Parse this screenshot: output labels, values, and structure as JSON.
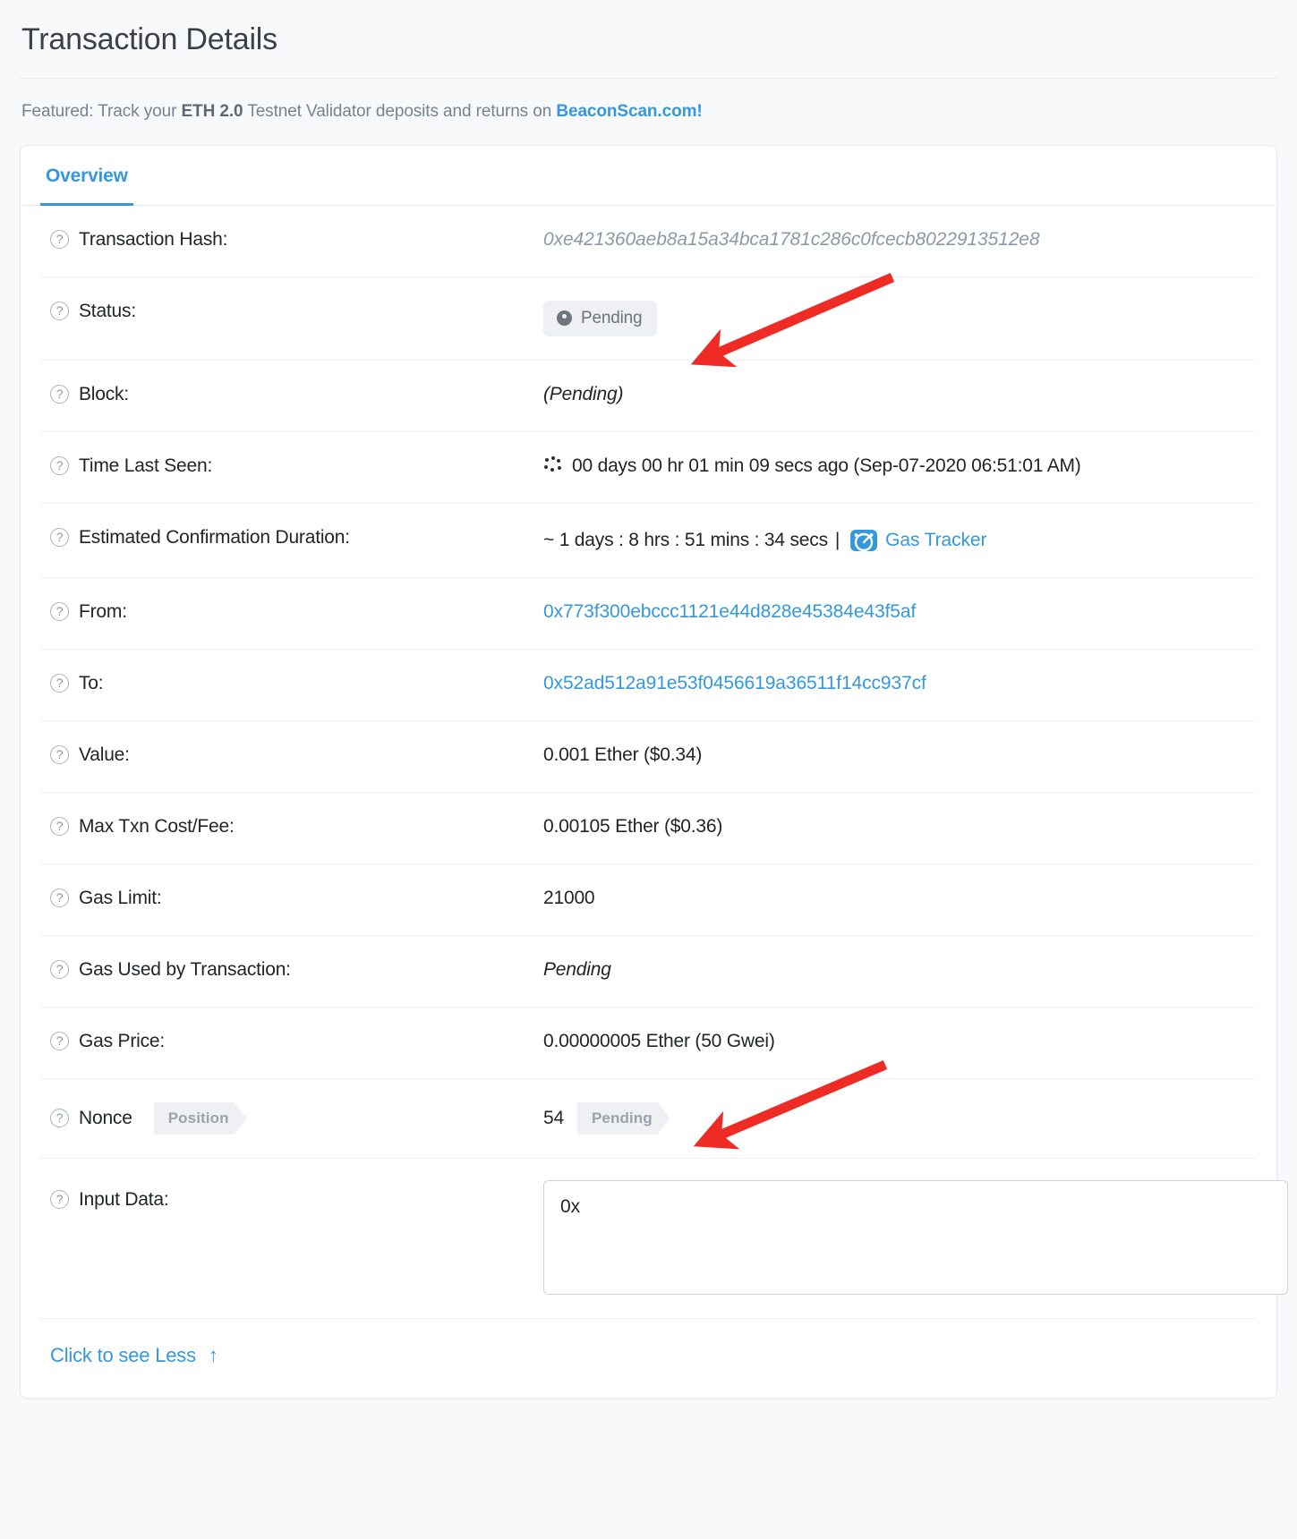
{
  "header": {
    "title": "Transaction Details"
  },
  "featured": {
    "prefix": "Featured: Track your ",
    "bold": "ETH 2.0",
    "middle": " Testnet Validator deposits and returns on ",
    "link": "BeaconScan.com!"
  },
  "tabs": [
    {
      "label": "Overview",
      "active": true
    }
  ],
  "rows": {
    "transaction_hash": {
      "label": "Transaction Hash:",
      "value": "0xe421360aeb8a15a34bca1781c286c0fcecb8022913512e8"
    },
    "status": {
      "label": "Status:",
      "badge": "Pending"
    },
    "block": {
      "label": "Block:",
      "value": "(Pending)"
    },
    "time_last_seen": {
      "label": "Time Last Seen:",
      "value": "00 days 00 hr 01 min 09 secs ago (Sep-07-2020 06:51:01 AM)"
    },
    "estimated_confirmation": {
      "label": "Estimated Confirmation Duration:",
      "value": "~ 1 days : 8 hrs : 51 mins : 34 secs",
      "separator": "|",
      "gas_tracker_link": "Gas Tracker"
    },
    "from": {
      "label": "From:",
      "value": "0x773f300ebccc1121e44d828e45384e43f5af"
    },
    "to": {
      "label": "To:",
      "value": "0x52ad512a91e53f0456619a36511f14cc937cf"
    },
    "value": {
      "label": "Value:",
      "value": "0.001 Ether ($0.34)"
    },
    "max_txn_cost": {
      "label": "Max Txn Cost/Fee:",
      "value": "0.00105 Ether ($0.36)"
    },
    "gas_limit": {
      "label": "Gas Limit:",
      "value": "21000"
    },
    "gas_used": {
      "label": "Gas Used by Transaction:",
      "value": "Pending"
    },
    "gas_price": {
      "label": "Gas Price:",
      "value": "0.00000005 Ether (50 Gwei)"
    },
    "nonce": {
      "label": "Nonce",
      "position_chip": "Position",
      "value": "54",
      "pending_chip": "Pending"
    },
    "input_data": {
      "label": "Input Data:",
      "value": "0x"
    }
  },
  "footer": {
    "see_less": "Click to see Less",
    "arrow": "↑"
  },
  "colors": {
    "accent_blue": "#3498db",
    "annotation_red": "#ee2b24",
    "muted_gray": "#77838f",
    "badge_bg": "#eef0f3",
    "page_bg": "#f8f9fa"
  }
}
